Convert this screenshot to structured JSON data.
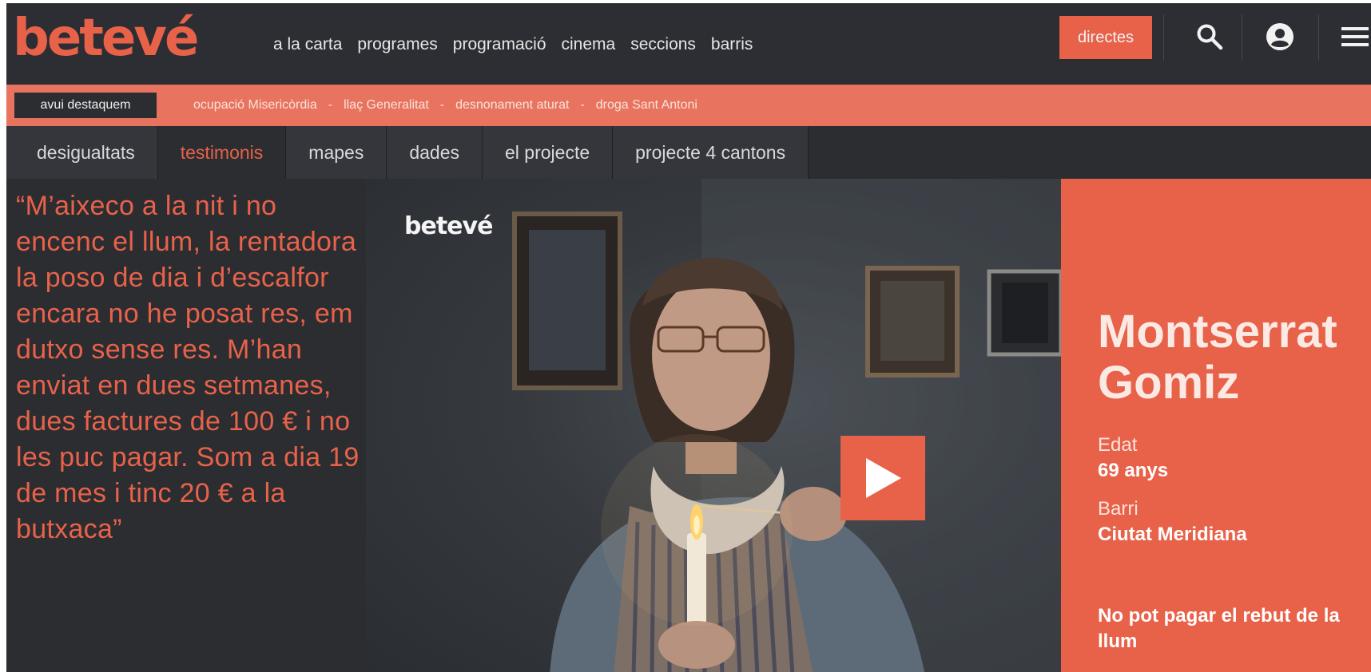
{
  "header": {
    "logo": "betevé",
    "nav": [
      "a la carta",
      "programes",
      "programació",
      "cinema",
      "seccions",
      "barris"
    ],
    "directes_label": "directes"
  },
  "highlights": {
    "label": "avui destaquem",
    "links": [
      "ocupació Misericòrdia",
      "llaç Generalitat",
      "desnonament aturat",
      "droga Sant Antoni"
    ],
    "separator": "-"
  },
  "subnav": {
    "tabs": [
      "desigualtats",
      "testimonis",
      "mapes",
      "dades",
      "el projecte",
      "projecte 4 cantons"
    ],
    "active": "testimonis"
  },
  "hero": {
    "quote": "“M’aixeco a la nit i no encenc el llum, la rentadora la poso de dia i d’escalfor encara no he posat res, em dutxo sense res. M’han enviat en dues setmanes, dues factures de 100 € i no les puc pagar. Som a dia 19 de mes i tinc 20 € a la butxaca”",
    "video_logo": "betevé",
    "person": {
      "name": "Montserrat\nGomiz",
      "age_label": "Edat",
      "age_value": "69 anys",
      "district_label": "Barri",
      "district_value": "Ciutat Meridiana",
      "note": "No pot pagar el rebut de la llum"
    }
  },
  "colors": {
    "accent": "#e8624a",
    "header_bg": "#2c2e33",
    "highlight_bar": "#e8735e"
  },
  "icons": [
    "search-icon",
    "user-account-icon",
    "hamburger-menu-icon",
    "play-icon"
  ]
}
